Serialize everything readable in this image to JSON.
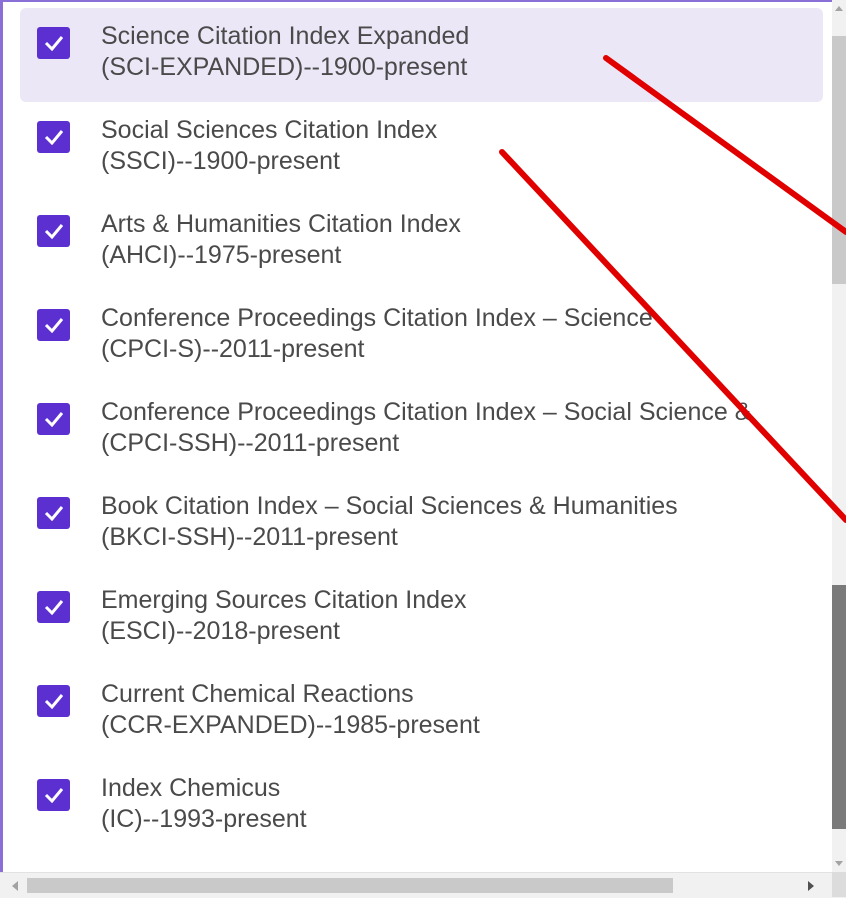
{
  "accent_color": "#5b2fd0",
  "highlight_color": "#ece7f7",
  "annotation_color": "#e00000",
  "indexes": [
    {
      "name": "Science Citation Index Expanded",
      "detail": "(SCI-EXPANDED)--1900-present",
      "checked": true,
      "highlighted": true
    },
    {
      "name": "Social Sciences Citation Index",
      "detail": "(SSCI)--1900-present",
      "checked": true,
      "highlighted": false
    },
    {
      "name": "Arts & Humanities Citation Index",
      "detail": "(AHCI)--1975-present",
      "checked": true,
      "highlighted": false
    },
    {
      "name": "Conference Proceedings Citation Index – Science",
      "detail": "(CPCI-S)--2011-present",
      "checked": true,
      "highlighted": false
    },
    {
      "name": "Conference Proceedings Citation Index – Social Science &",
      "detail": "(CPCI-SSH)--2011-present",
      "checked": true,
      "highlighted": false
    },
    {
      "name": "Book Citation Index – Social Sciences & Humanities",
      "detail": "(BKCI-SSH)--2011-present",
      "checked": true,
      "highlighted": false
    },
    {
      "name": "Emerging Sources Citation Index",
      "detail": "(ESCI)--2018-present",
      "checked": true,
      "highlighted": false
    },
    {
      "name": "Current Chemical Reactions",
      "detail": "(CCR-EXPANDED)--1985-present",
      "checked": true,
      "highlighted": false
    },
    {
      "name": "Index Chemicus",
      "detail": "(IC)--1993-present",
      "checked": true,
      "highlighted": false
    }
  ],
  "icons": {
    "checkbox": "checkmark-icon",
    "scroll_up": "arrow-up-icon",
    "scroll_down": "arrow-down-icon",
    "scroll_left": "arrow-left-icon",
    "scroll_right": "arrow-right-icon"
  }
}
